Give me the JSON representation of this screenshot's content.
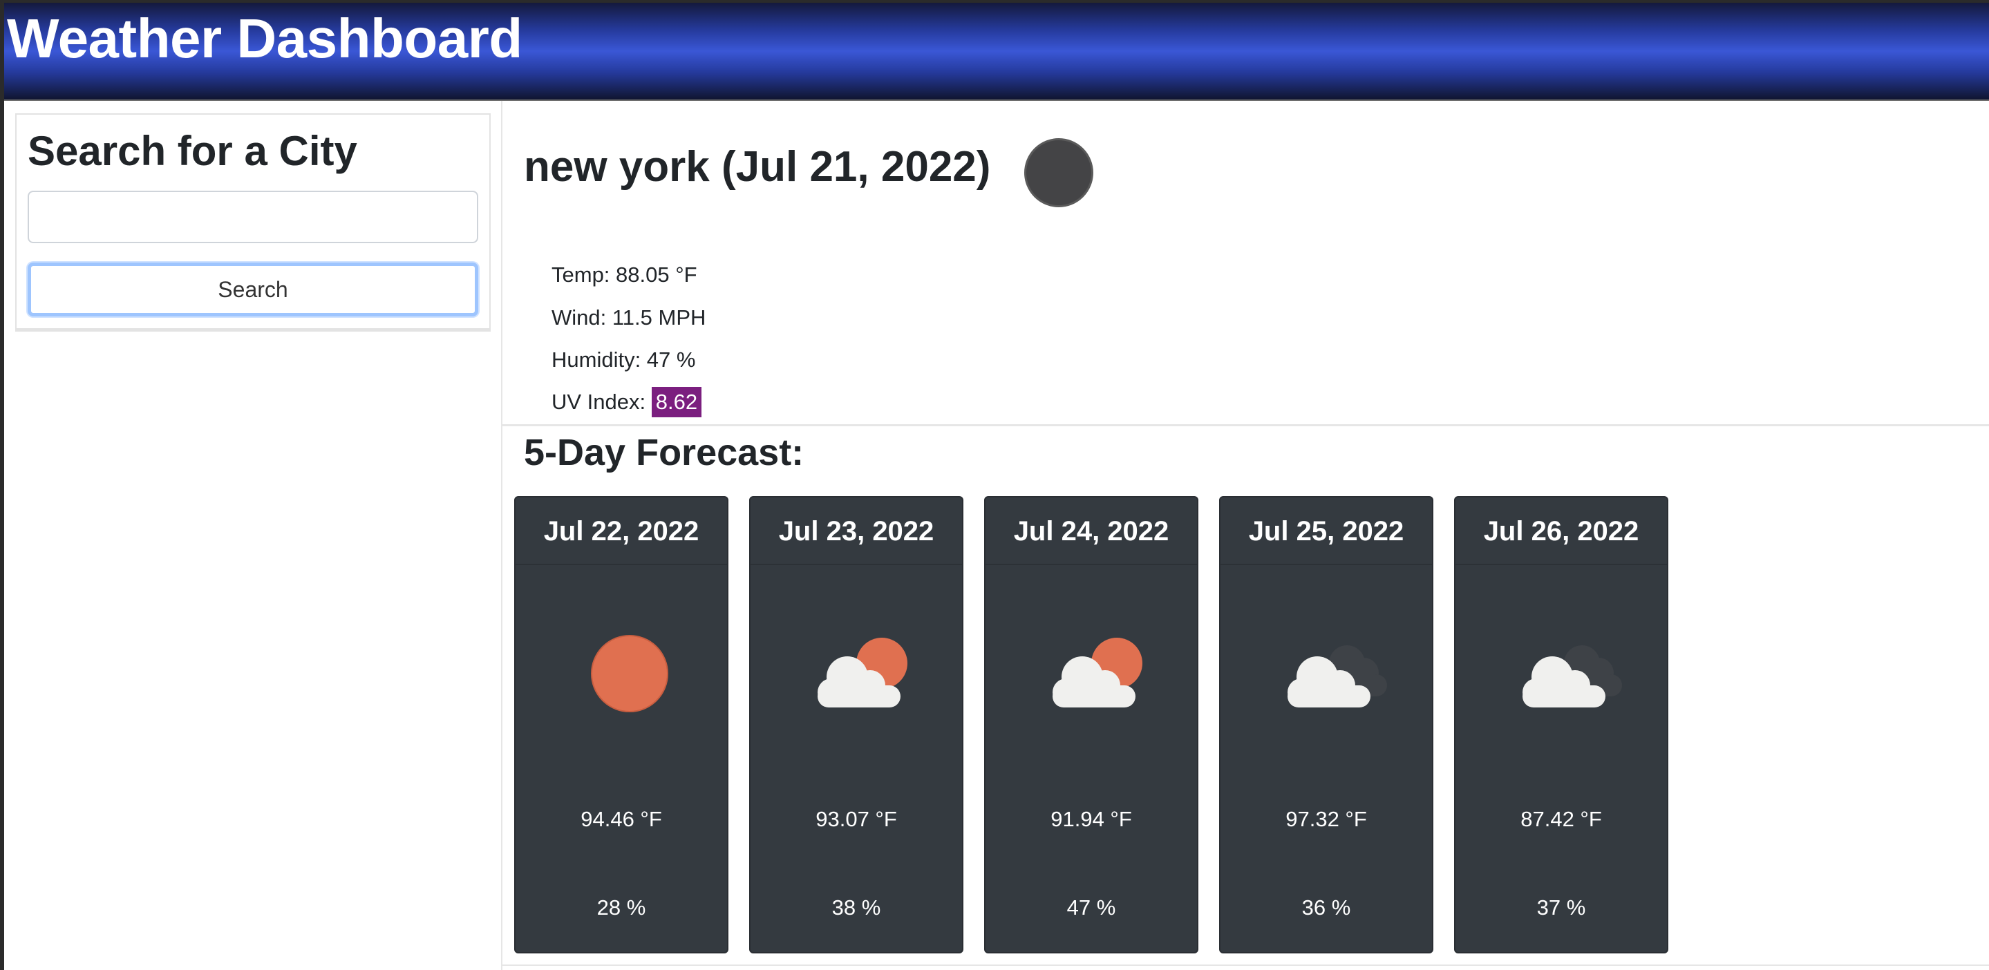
{
  "header": {
    "title": "Weather Dashboard"
  },
  "search": {
    "heading": "Search for a City",
    "input_value": "",
    "input_placeholder": "",
    "button_label": "Search"
  },
  "current": {
    "title": "new york (Jul 21, 2022)",
    "icon": "weather-icon-dark-circle",
    "temp": "Temp: 88.05 °F",
    "wind": "Wind: 11.5 MPH",
    "humidity": "Humidity: 47 %",
    "uv_label": "UV Index: ",
    "uv_value": "8.62",
    "uv_color": "#7b1f7f"
  },
  "forecast": {
    "title": "5-Day Forecast:",
    "days": [
      {
        "date": "Jul 22, 2022",
        "icon": "sun-icon",
        "temp": "94.46 °F",
        "humidity": "28 %"
      },
      {
        "date": "Jul 23, 2022",
        "icon": "partly-cloudy-icon",
        "temp": "93.07 °F",
        "humidity": "38 %"
      },
      {
        "date": "Jul 24, 2022",
        "icon": "partly-cloudy-icon",
        "temp": "91.94 °F",
        "humidity": "47 %"
      },
      {
        "date": "Jul 25, 2022",
        "icon": "cloudy-icon",
        "temp": "97.32 °F",
        "humidity": "36 %"
      },
      {
        "date": "Jul 26, 2022",
        "icon": "cloudy-icon",
        "temp": "87.42 °F",
        "humidity": "37 %"
      }
    ]
  },
  "colors": {
    "header_gradient_mid": "#3a57d6",
    "card_background": "#343a40",
    "sun": "#e07050",
    "cloud": "#f0f0ee",
    "dark_cloud": "#3e4247"
  }
}
